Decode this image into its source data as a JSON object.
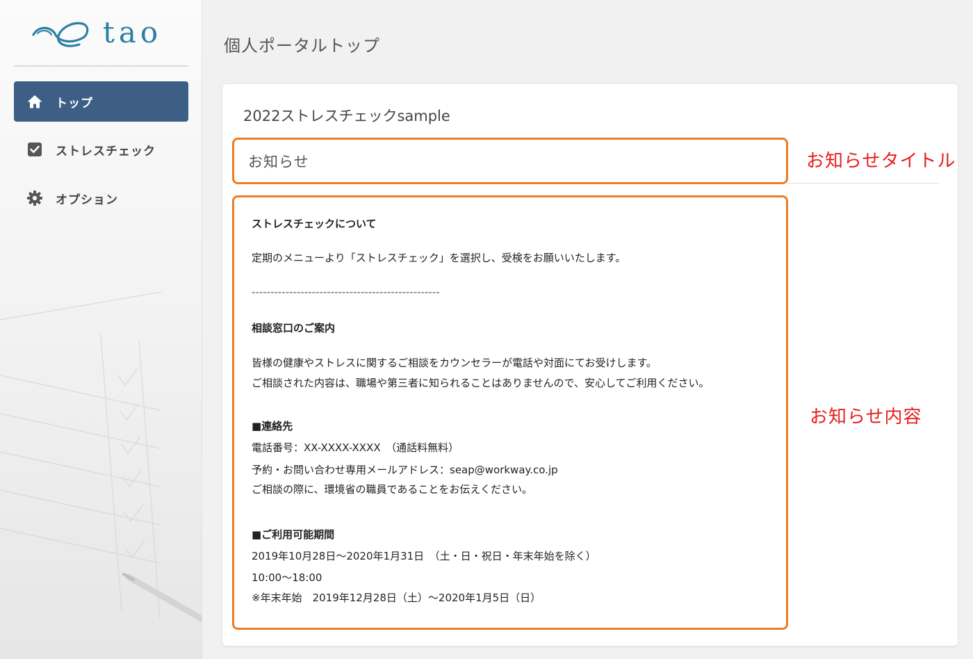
{
  "sidebar": {
    "logo_text": "tao",
    "items": [
      {
        "label": "トップ",
        "icon": "home-icon",
        "active": true
      },
      {
        "label": "ストレスチェック",
        "icon": "checkbox-icon",
        "active": false
      },
      {
        "label": "オプション",
        "icon": "gear-icon",
        "active": false
      }
    ]
  },
  "main": {
    "page_title": "個人ポータルトップ",
    "card_title": "2022ストレスチェックsample",
    "notice_title": "お知らせ",
    "notice_body": [
      "ストレスチェックについて",
      "定期のメニューより「ストレスチェック」を選択し、受検をお願いいたします。",
      "--------------------------------------------------",
      "相談窓口のご案内",
      "皆様の健康やストレスに関するご相談をカウンセラーが電話や対面にてお受けします。",
      "ご相談された内容は、職場や第三者に知られることはありませんので、安心してご利用ください。",
      "■連絡先",
      "電話番号：XX-XXXX-XXXX　（通話料無料）",
      "予約・お問い合わせ専用メールアドレス：seap@workway.co.jp",
      "ご相談の際に、環境省の職員であることをお伝えください。",
      "■ご利用可能期間",
      "2019年10月28日～2020年1月31日　（土・日・祝日・年末年始を除く）",
      "10:00～18:00",
      "※年末年始　2019年12月28日（土）～2020年1月5日（日）"
    ]
  },
  "annotations": {
    "title_label": "お知らせタイトル",
    "content_label": "お知らせ内容"
  },
  "colors": {
    "accent_orange": "#ee7d22",
    "nav_active": "#3d5f86",
    "annotation_red": "#e61e1e",
    "logo_blue": "#2b7fa3"
  }
}
